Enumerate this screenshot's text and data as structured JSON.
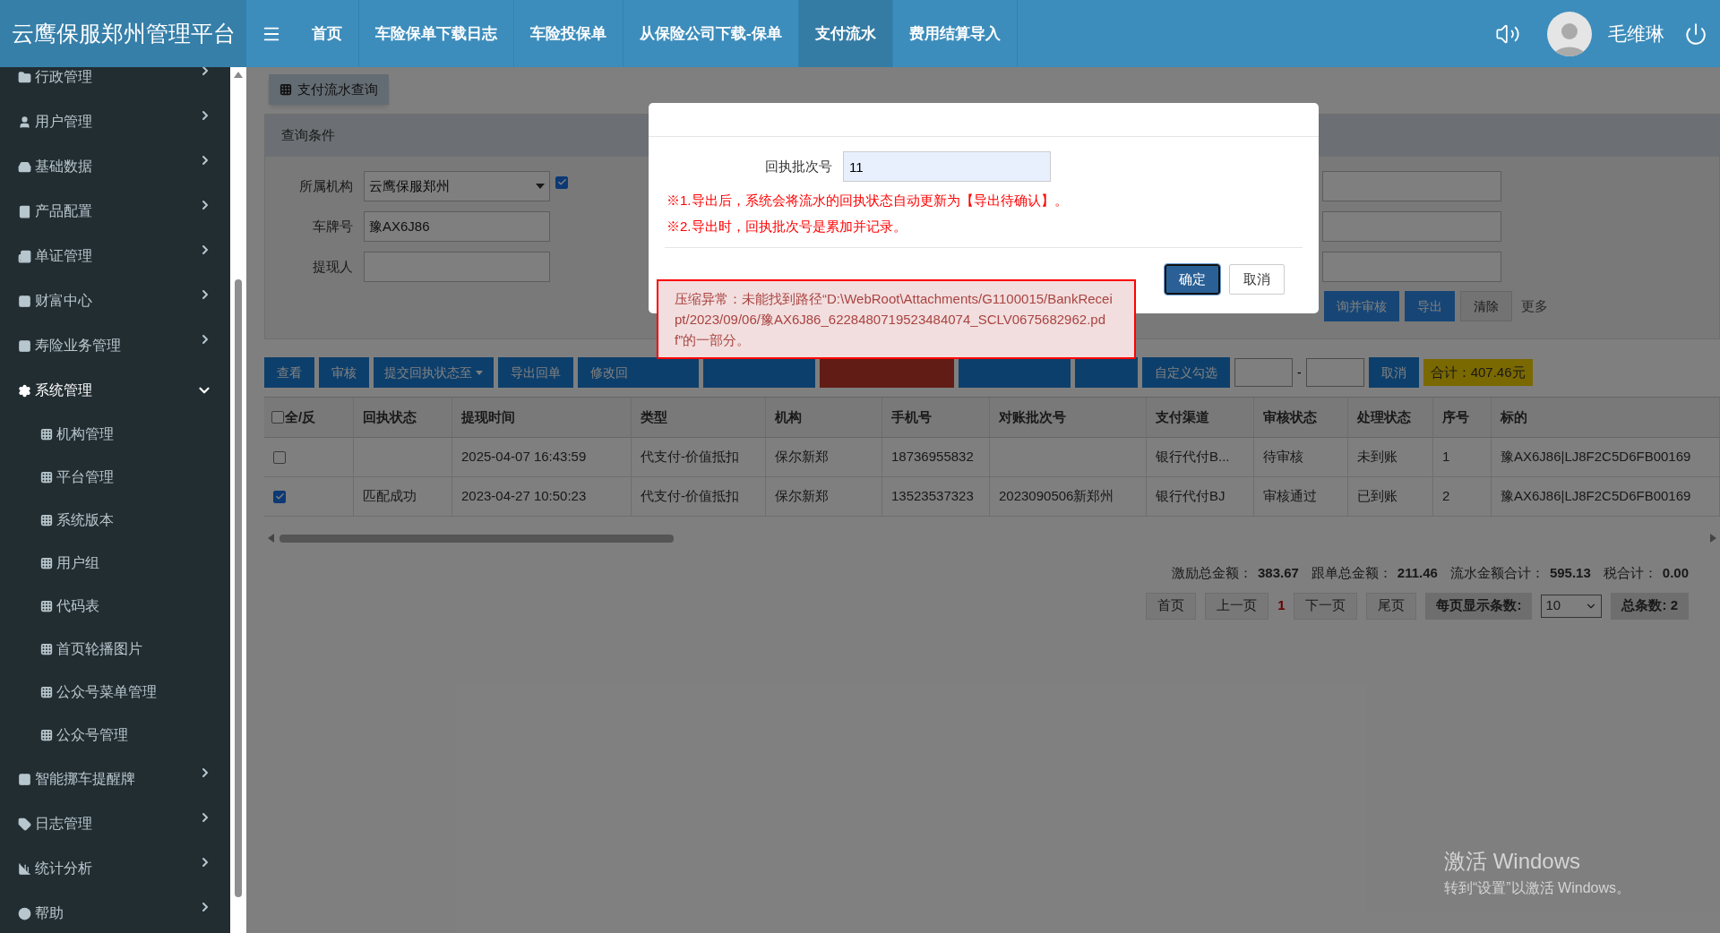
{
  "top_bar": {
    "brand": "云鹰保服郑州管理平台",
    "nav": [
      {
        "label": "首页",
        "selected": false
      },
      {
        "label": "车险保单下载日志",
        "selected": false
      },
      {
        "label": "车险投保单",
        "selected": false
      },
      {
        "label": "从保险公司下载-保单",
        "selected": false
      },
      {
        "label": "支付流水",
        "selected": true
      },
      {
        "label": "费用结算导入",
        "selected": false
      }
    ],
    "user": {
      "name": "毛维琳"
    }
  },
  "sidebar": {
    "items": [
      {
        "label": "行政管理",
        "expanded": false
      },
      {
        "label": "用户管理",
        "expanded": false
      },
      {
        "label": "基础数据",
        "expanded": false
      },
      {
        "label": "产品配置",
        "expanded": false
      },
      {
        "label": "单证管理",
        "expanded": false
      },
      {
        "label": "财富中心",
        "expanded": false
      },
      {
        "label": "寿险业务管理",
        "expanded": false
      },
      {
        "label": "系统管理",
        "expanded": true,
        "children": [
          {
            "label": "机构管理"
          },
          {
            "label": "平台管理"
          },
          {
            "label": "系统版本"
          },
          {
            "label": "用户组"
          },
          {
            "label": "代码表"
          },
          {
            "label": "首页轮播图片"
          },
          {
            "label": "公众号菜单管理"
          },
          {
            "label": "公众号管理"
          }
        ]
      },
      {
        "label": "智能挪车提醒牌",
        "expanded": false
      },
      {
        "label": "日志管理",
        "expanded": false
      },
      {
        "label": "统计分析",
        "expanded": false
      },
      {
        "label": "帮助",
        "expanded": false
      }
    ]
  },
  "query": {
    "tab": "支付流水查询",
    "panel_title": "查询条件",
    "fields": [
      {
        "label": "所属机构",
        "kind": "select",
        "value": "云鹰保服郑州",
        "checked": true
      },
      {
        "label": "车牌号",
        "kind": "text",
        "value": "豫AX6J86"
      },
      {
        "label": "提现人",
        "kind": "text"
      }
    ],
    "buttons": [
      {
        "label": "询并审核",
        "kind": "primary"
      },
      {
        "label": "导出",
        "kind": "primary"
      },
      {
        "label": "清除",
        "kind": "default"
      }
    ],
    "more": "更多"
  },
  "toolbar": {
    "buttons": [
      {
        "label": "查看",
        "kind": "button"
      },
      {
        "label": "审核",
        "kind": "button"
      },
      {
        "label": "提交回执状态至",
        "kind": "dropdown"
      },
      {
        "label": "导出回单",
        "kind": "button"
      },
      {
        "label": "修改回",
        "kind": "covered"
      },
      {
        "kind": "covered"
      },
      {
        "kind": "covered_danger"
      },
      {
        "kind": "covered"
      },
      {
        "kind": "covered"
      },
      {
        "label": "自定义勾选",
        "kind": "button"
      }
    ],
    "range_separator": "-",
    "cancel": "取消",
    "total": "合计：407.46元"
  },
  "table": {
    "select_all": "全/反",
    "select_all_checked": false,
    "columns": [
      "回执状态",
      "提现时间",
      "类型",
      "机构",
      "手机号",
      "对账批次号",
      "支付渠道",
      "审核状态",
      "处理状态",
      "序号",
      "标的"
    ],
    "rows": [
      {
        "checked": false,
        "cells": [
          "",
          "2025-04-07 16:43:59",
          "代支付-价值抵扣",
          "保尔新郑",
          "18736955832",
          "",
          "银行代付B...",
          "待审核",
          "未到账",
          "1",
          "豫AX6J86|LJ8F2C5D6FB00169"
        ]
      },
      {
        "checked": true,
        "cells": [
          "匹配成功",
          "2023-04-27 10:50:23",
          "代支付-价值抵扣",
          "保尔新郑",
          "13523537323",
          "2023090506新郑州",
          "银行代付BJ",
          "审核通过",
          "已到账",
          "2",
          "豫AX6J86|LJ8F2C5D6FB00169"
        ]
      }
    ]
  },
  "summary": [
    {
      "label": "激励总金额：",
      "value": "383.67"
    },
    {
      "label": "跟单总金额：",
      "value": "211.46"
    },
    {
      "label": "流水金额合计：",
      "value": "595.13"
    },
    {
      "label": "税合计：",
      "value": "0.00"
    }
  ],
  "pagination": {
    "first": "首页",
    "prev": "上一页",
    "current": "1",
    "next": "下一页",
    "last": "尾页",
    "page_size_label": "每页显示条数:",
    "page_size": "10",
    "total": "总条数: 2"
  },
  "modal": {
    "field": {
      "label": "回执批次号",
      "value": "11"
    },
    "notes": [
      "※1.导出后，系统会将流水的回执状态自动更新为【导出待确认】。",
      "※2.导出时，回执批次号是累加并记录。"
    ],
    "buttons": [
      {
        "label": "确定",
        "kind": "primary"
      },
      {
        "label": "取消",
        "kind": "default"
      }
    ]
  },
  "error": {
    "text": "压缩异常：未能找到路径“D:\\WebRoot\\Attachments/G1100015/BankReceipt/2023/09/06/豫AX6J86_6228480719523484074_SCLV0675682962.pdf”的一部分。"
  },
  "os_notice": {
    "title": "激活 Windows",
    "text": "转到“设置”以激活 Windows。"
  }
}
